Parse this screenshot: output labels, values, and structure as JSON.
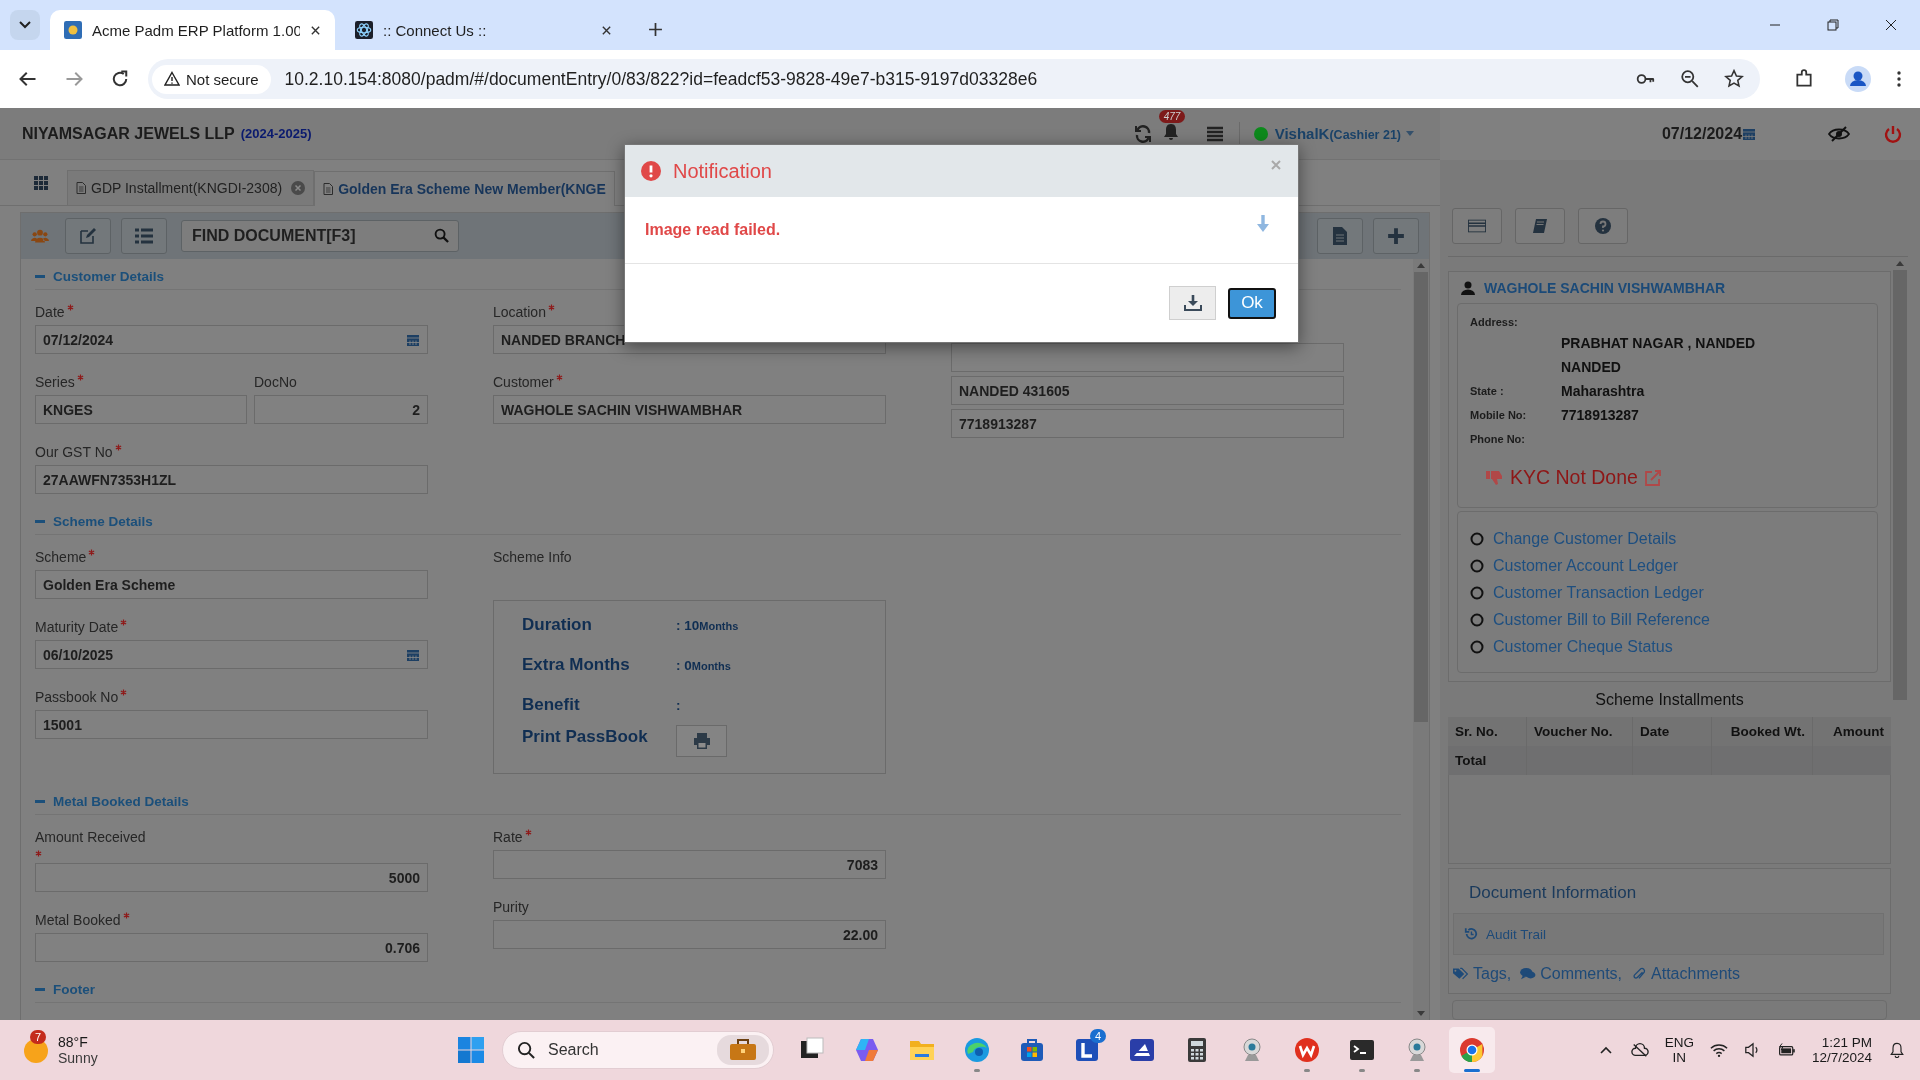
{
  "browser": {
    "tabs": [
      {
        "title": "Acme Padm ERP Platform 1.00",
        "selected": true
      },
      {
        "title": ":: Connect Us ::",
        "selected": false
      }
    ],
    "security": "Not secure",
    "url": "10.2.10.154:8080/padm/#/documentEntry/0/83/822?id=feadcf53-9828-49e7-b315-9197d03328e6"
  },
  "header": {
    "company": "NIYAMSAGAR JEWELS LLP",
    "year": "(2024-2025)",
    "notification_count": "477",
    "user": "VishalK",
    "role": "(Cashier 21)",
    "date": "07/12/2024"
  },
  "doc_tabs": [
    {
      "label": "GDP Installment(KNGDI-2308)",
      "selected": false,
      "closable": true
    },
    {
      "label": "Golden Era Scheme New Member(KNGE",
      "selected": true,
      "closable": false
    }
  ],
  "find": {
    "placeholder": "FIND DOCUMENT[F3]"
  },
  "customer_details": {
    "title": "Customer Details",
    "date": {
      "label": "Date",
      "required": true,
      "value": "07/12/2024"
    },
    "series": {
      "label": "Series",
      "required": true,
      "value": "KNGES"
    },
    "doc_no": {
      "label": "DocNo",
      "required": false,
      "value": "2"
    },
    "gst": {
      "label": "Our GST No",
      "required": true,
      "value": "27AAWFN7353H1ZL"
    },
    "location": {
      "label": "Location",
      "required": true,
      "value": "NANDED BRANCH"
    },
    "customer": {
      "label": "Customer",
      "required": true,
      "value": "WAGHOLE SACHIN VISHWAMBHAR"
    },
    "address_lines": [
      "NANDED 431605",
      "7718913287"
    ]
  },
  "scheme_details": {
    "title": "Scheme Details",
    "scheme": {
      "label": "Scheme",
      "required": true,
      "value": "Golden Era Scheme"
    },
    "maturity": {
      "label": "Maturity Date",
      "required": true,
      "value": "06/10/2025"
    },
    "passbook": {
      "label": "Passbook No",
      "required": true,
      "value": "15001"
    },
    "info_title": "Scheme Info",
    "info_rows": [
      {
        "label": "Duration",
        "value": ": 10",
        "unit": "Months"
      },
      {
        "label": "Extra Months",
        "value": ": 0",
        "unit": "Months"
      },
      {
        "label": "Benefit",
        "value": ":"
      }
    ],
    "print_label": "Print PassBook"
  },
  "metal_details": {
    "title": "Metal Booked Details",
    "amount": {
      "label": "Amount Received",
      "required": true,
      "value": "5000"
    },
    "metal": {
      "label": "Metal Booked",
      "required": true,
      "value": "0.706"
    },
    "rate": {
      "label": "Rate",
      "required": true,
      "value": "7083"
    },
    "purity": {
      "label": "Purity",
      "required": false,
      "value": "22.00"
    }
  },
  "footer": {
    "title": "Footer"
  },
  "side": {
    "customer_name": "WAGHOLE SACHIN VISHWAMBHAR",
    "address_label": "Address:",
    "address_lines": [
      "PRABHAT NAGAR , NANDED",
      "NANDED"
    ],
    "state_label": "State :",
    "state": "Maharashtra",
    "mobile_label": "Mobile No:",
    "mobile": "7718913287",
    "phone_label": "Phone No:",
    "kyc": "KYC Not Done",
    "links": [
      "Change Customer Details",
      "Customer Account Ledger",
      "Customer Transaction Ledger",
      "Customer Bill to Bill Reference",
      "Customer Cheque Status"
    ],
    "installments": {
      "title": "Scheme Installments",
      "columns": [
        "Sr. No.",
        "Voucher No.",
        "Date",
        "Booked Wt.",
        "Amount"
      ],
      "total": "Total"
    },
    "doc_info": {
      "title": "Document Information",
      "audit": "Audit Trail",
      "tags": "Tags,",
      "comments": "Comments,",
      "attachments": "Attachments"
    }
  },
  "modal": {
    "title": "Notification",
    "message": "Image read failed.",
    "ok": "Ok"
  },
  "taskbar": {
    "weather": {
      "badge": "7",
      "temp": "88°F",
      "condition": "Sunny"
    },
    "search": "Search",
    "apps": [
      {
        "kind": "taskview",
        "running": false,
        "selected": false
      },
      {
        "kind": "copilot",
        "running": false,
        "selected": false
      },
      {
        "kind": "files",
        "running": false,
        "selected": false
      },
      {
        "kind": "edge",
        "running": true,
        "selected": false
      },
      {
        "kind": "store",
        "running": false,
        "selected": false
      },
      {
        "kind": "launcher",
        "running": false,
        "selected": false,
        "badge": "4"
      },
      {
        "kind": "scanner",
        "running": false,
        "selected": false
      },
      {
        "kind": "calculator",
        "running": false,
        "selected": false
      },
      {
        "kind": "webcam",
        "running": false,
        "selected": false
      },
      {
        "kind": "office",
        "running": true,
        "selected": false
      },
      {
        "kind": "terminal",
        "running": true,
        "selected": false
      },
      {
        "kind": "webcam",
        "running": true,
        "selected": false
      },
      {
        "kind": "chrome",
        "running": true,
        "selected": true
      }
    ],
    "lang": "ENG",
    "region": "IN",
    "time": "1:21 PM",
    "date": "12/7/2024"
  }
}
